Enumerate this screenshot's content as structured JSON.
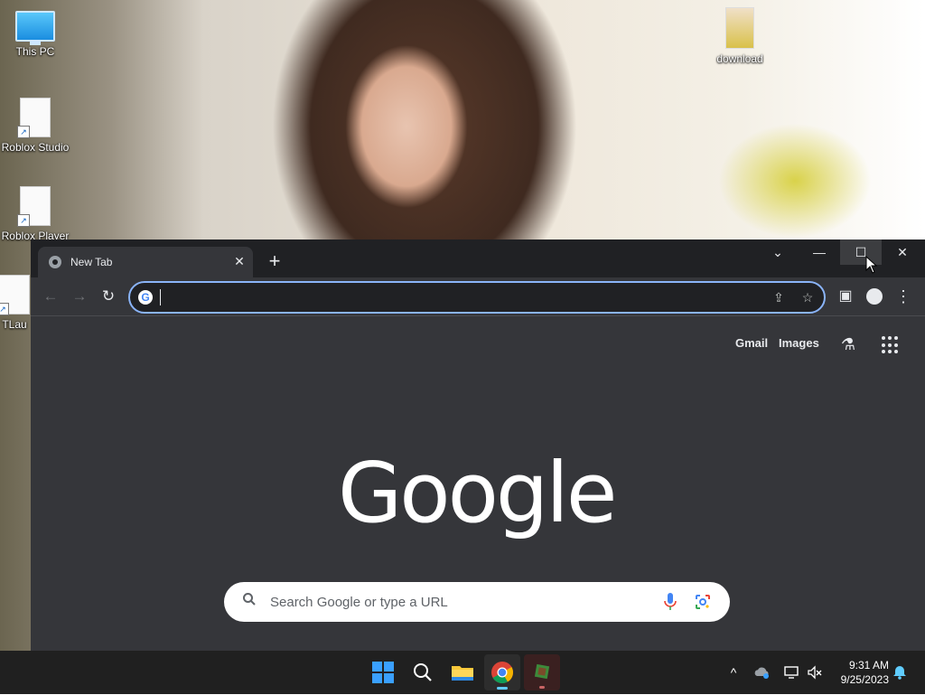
{
  "desktop": {
    "icons": [
      {
        "label": "This PC"
      },
      {
        "label": "Roblox Studio"
      },
      {
        "label": "Roblox Player"
      },
      {
        "label": "TLau"
      },
      {
        "label": "download"
      }
    ]
  },
  "browser": {
    "tab": {
      "title": "New Tab",
      "close_glyph": "✕"
    },
    "new_tab_glyph": "+",
    "window_controls": {
      "dropdown": "⌄",
      "minimize": "—",
      "maximize": "☐",
      "close": "✕"
    },
    "toolbar": {
      "back_glyph": "←",
      "forward_glyph": "→",
      "reload_glyph": "↻",
      "omnibox_value": "",
      "share_glyph": "⇪",
      "bookmark_glyph": "☆",
      "sidepanel_glyph": "▣",
      "profile_glyph": "●",
      "menu_glyph": "⋮"
    },
    "content": {
      "links": {
        "gmail": "Gmail",
        "images": "Images"
      },
      "labs_glyph": "⚗",
      "logo": "Google",
      "search_placeholder": "Search Google or type a URL",
      "search_glyph": "🔍"
    }
  },
  "taskbar": {
    "tray": {
      "chevron": "^",
      "time": "9:31 AM",
      "date": "9/25/2023"
    }
  },
  "colors": {
    "chrome_dark": "#202124",
    "chrome_surface": "#35363a",
    "focus_ring": "#8ab4f8",
    "taskbar": "#202020"
  }
}
